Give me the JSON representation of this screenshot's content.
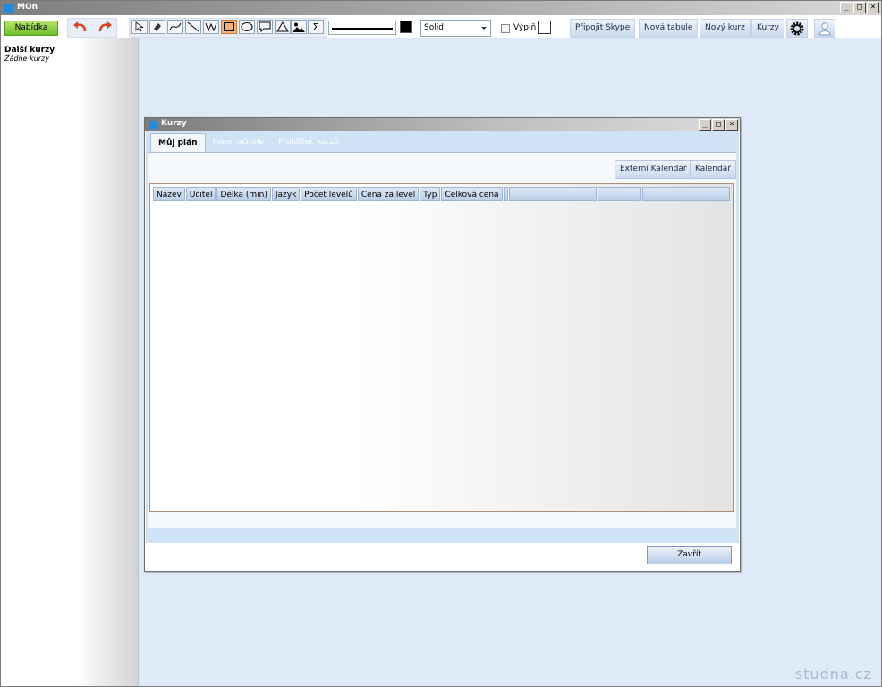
{
  "app": {
    "title": "MOn"
  },
  "window_buttons": [
    "_",
    "□",
    "×"
  ],
  "toolbar": {
    "menu_label": "Nabídka",
    "line_style": "Solid",
    "fill_label": "Výplň",
    "connect_skype": "Připojit Skype",
    "new_board": "Nová tabule",
    "new_course": "Nový kurz",
    "courses": "Kurzy",
    "tools": [
      "pointer-tool",
      "eraser-tool",
      "curve-tool",
      "line-tool",
      "polyline-tool",
      "rectangle-tool",
      "ellipse-tool",
      "callout-tool",
      "triangle-tool",
      "image-tool",
      "sigma-tool"
    ],
    "active_tool": "rectangle-tool",
    "stroke_color": "#000000",
    "fill_color": "#ffffff"
  },
  "sidebar": {
    "title": "Další kurzy",
    "subtitle": "Žádne kurzy"
  },
  "dialog": {
    "title": "Kurzy",
    "tabs": [
      {
        "label": "Můj plán",
        "active": true
      },
      {
        "label": "Panel učitele",
        "active": false
      },
      {
        "label": "Prohlížeč kurzů",
        "active": false
      }
    ],
    "buttons": {
      "external_calendar": "Externí Kalendář",
      "calendar": "Kalendář",
      "close": "Zavřít"
    },
    "columns": [
      "Název",
      "Učitel",
      "Délka (min)",
      "Jazyk",
      "Počet levelů",
      "Cena za level",
      "Typ",
      "Celková cena",
      "",
      "",
      "",
      ""
    ],
    "rows": []
  },
  "watermark": "studna.cz",
  "colors": {
    "menu_green": "#6dbf2c",
    "workspace": "#deeaf7",
    "accent_blue": "#1d8ce0",
    "active_tool": "#f5b37a",
    "undo_red": "#e2401c"
  }
}
